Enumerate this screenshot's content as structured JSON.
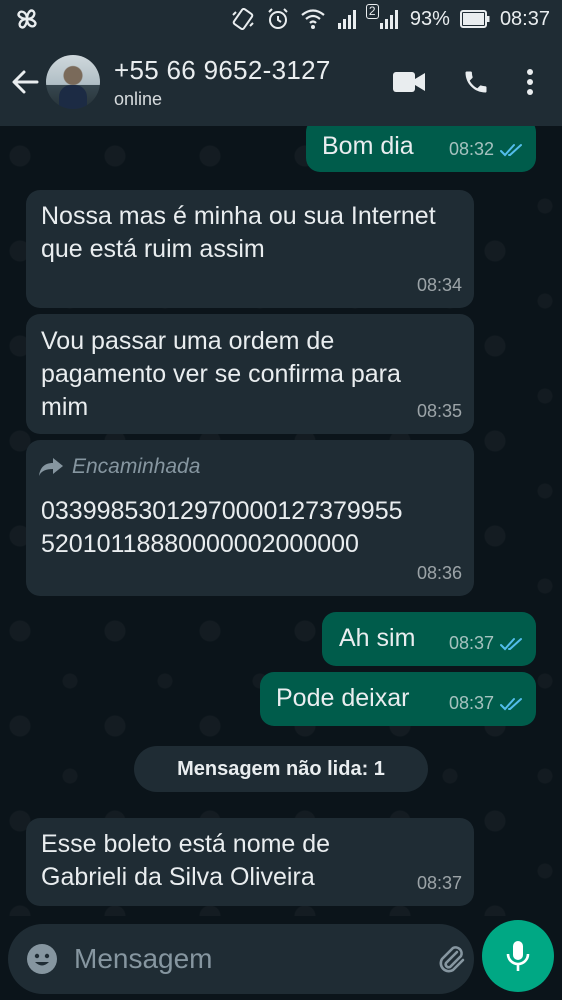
{
  "status_bar": {
    "battery_percent": "93%",
    "time": "08:37",
    "sim2_label": "2"
  },
  "header": {
    "contact_name": "+55 66 9652-3127",
    "contact_status": "online"
  },
  "messages": [
    {
      "direction": "out",
      "text": "Bom dia",
      "time": "08:32",
      "status": "read"
    },
    {
      "direction": "in",
      "text": "Nossa mas é minha ou sua Internet que está ruim assim",
      "time": "08:34"
    },
    {
      "direction": "in",
      "text": "Vou passar uma ordem de pagamento ver se confirma para mim",
      "time": "08:35"
    },
    {
      "direction": "in",
      "forwarded_label": "Encaminhada",
      "text_line1": "03399853012970000127379955",
      "text_line2": "52010118880000002000000",
      "time": "08:36"
    },
    {
      "direction": "out",
      "text": "Ah sim",
      "time": "08:37",
      "status": "read"
    },
    {
      "direction": "out",
      "text": "Pode deixar",
      "time": "08:37",
      "status": "read"
    },
    {
      "direction": "in",
      "text": "Esse boleto está nome de Gabrieli da Silva Oliveira",
      "time": "08:37"
    }
  ],
  "unread_divider": "Mensagem não lida: 1",
  "composer": {
    "placeholder": "Mensagem"
  },
  "colors": {
    "background": "#0b141a",
    "incoming_bubble": "#1f2c34",
    "outgoing_bubble": "#005c4b",
    "read_ticks": "#53bdeb",
    "accent": "#00a884"
  },
  "icons": {
    "status_left": "pinwheel-icon",
    "back": "back-arrow-icon",
    "video": "video-call-icon",
    "phone": "phone-call-icon",
    "menu": "more-vert-icon",
    "emoji": "emoji-icon",
    "attach": "paperclip-icon",
    "camera": "camera-icon",
    "mic": "mic-icon"
  }
}
